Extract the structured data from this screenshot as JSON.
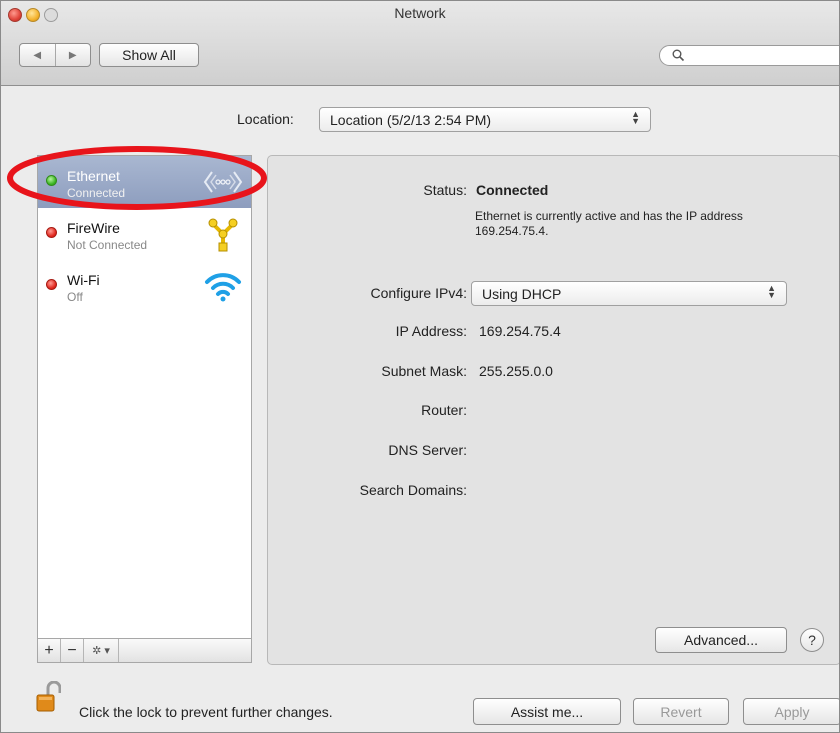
{
  "window": {
    "title": "Network"
  },
  "toolbar": {
    "back_label": "◀",
    "forward_label": "▶",
    "show_all": "Show All",
    "search_placeholder": ""
  },
  "location": {
    "label": "Location:",
    "value": "Location (5/2/13 2:54 PM)"
  },
  "sidebar": {
    "items": [
      {
        "name": "Ethernet",
        "status": "Connected",
        "status_color": "green",
        "icon": "ethernet-icon",
        "selected": true
      },
      {
        "name": "FireWire",
        "status": "Not Connected",
        "status_color": "red",
        "icon": "firewire-icon",
        "selected": false
      },
      {
        "name": "Wi-Fi",
        "status": "Off",
        "status_color": "red",
        "icon": "wifi-icon",
        "selected": false
      }
    ],
    "add_label": "+",
    "remove_label": "−",
    "gear_label": "✲ ▾"
  },
  "detail": {
    "status_label": "Status:",
    "status_value": "Connected",
    "status_desc": "Ethernet is currently active and has the IP address 169.254.75.4.",
    "configure_label": "Configure IPv4:",
    "configure_value": "Using DHCP",
    "ip_label": "IP Address:",
    "ip_value": "169.254.75.4",
    "subnet_label": "Subnet Mask:",
    "subnet_value": "255.255.0.0",
    "router_label": "Router:",
    "dns_label": "DNS Server:",
    "search_domains_label": "Search Domains:",
    "advanced_label": "Advanced...",
    "help_label": "?"
  },
  "footer": {
    "lock_text": "Click the lock to prevent further changes.",
    "assist_label": "Assist me...",
    "revert_label": "Revert",
    "apply_label": "Apply"
  },
  "colors": {
    "highlight_ring": "#e8141b",
    "selection": "#9aa8c8"
  }
}
